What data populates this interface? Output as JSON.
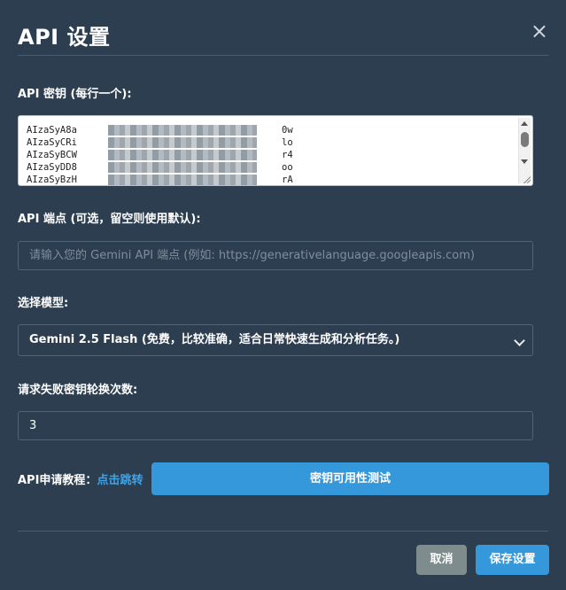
{
  "dialog": {
    "title": "API 设置",
    "close_glyph": "×"
  },
  "api_keys": {
    "label": "API 密钥 (每行一个):",
    "lines": [
      {
        "prefix": "AIzaSyA8a",
        "suffix": "0w"
      },
      {
        "prefix": "AIzaSyCRi",
        "suffix": "lo"
      },
      {
        "prefix": "AIzaSyBCW",
        "suffix": "r4"
      },
      {
        "prefix": "AIzaSyDD8",
        "suffix": "oo"
      },
      {
        "prefix": "AIzaSyBzH",
        "suffix": "rA"
      }
    ]
  },
  "endpoint": {
    "label": "API 端点 (可选，留空则使用默认):",
    "placeholder": "请输入您的 Gemini API 端点 (例如: https://generativelanguage.googleapis.com)",
    "value": ""
  },
  "model": {
    "label": "选择模型:",
    "selected": "Gemini 2.5 Flash (免费，比较准确，适合日常快速生成和分析任务。)"
  },
  "retry": {
    "label": "请求失败密钥轮换次数:",
    "value": "3"
  },
  "tutorial": {
    "label": "API申请教程：",
    "link": "点击跳转"
  },
  "buttons": {
    "test": "密钥可用性测试",
    "cancel": "取消",
    "save": "保存设置"
  },
  "colors": {
    "background": "#2c3e50",
    "accent": "#3498db",
    "cancel": "#7f8c8d",
    "link": "#3fa3e8"
  }
}
